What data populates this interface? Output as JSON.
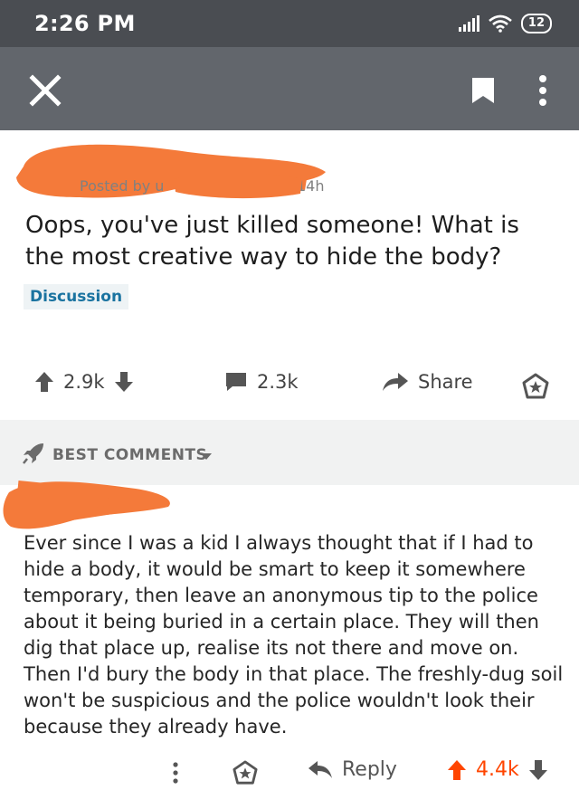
{
  "status_bar": {
    "time": "2:26 PM",
    "battery": "12"
  },
  "post": {
    "posted_by": "Posted by u",
    "age": "14h",
    "title": "Oops, you've just killed someone! What is the most creative way to hide the body?",
    "flair": "Discussion",
    "score": "2.9k",
    "comments": "2.3k",
    "share_label": "Share"
  },
  "comments_header": {
    "label": "BEST COMMENTS"
  },
  "comment": {
    "body": "Ever since I was a kid I always thought that if I had to hide a body, it would be smart to keep it somewhere temporary, then leave an anonymous tip to the police about it being buried in a certain place. They will then dig that place up, realise its not there and move on. Then I'd bury the body in that place. The freshly-dug soil won't be suspicious and the police wouldn't look their because they already have.",
    "reply_label": "Reply",
    "score": "4.4k"
  },
  "colors": {
    "upvote": "#ff4500",
    "redaction": "#f47a3a",
    "status_bar": "#4a4d52",
    "toolbar": "#62666c"
  }
}
